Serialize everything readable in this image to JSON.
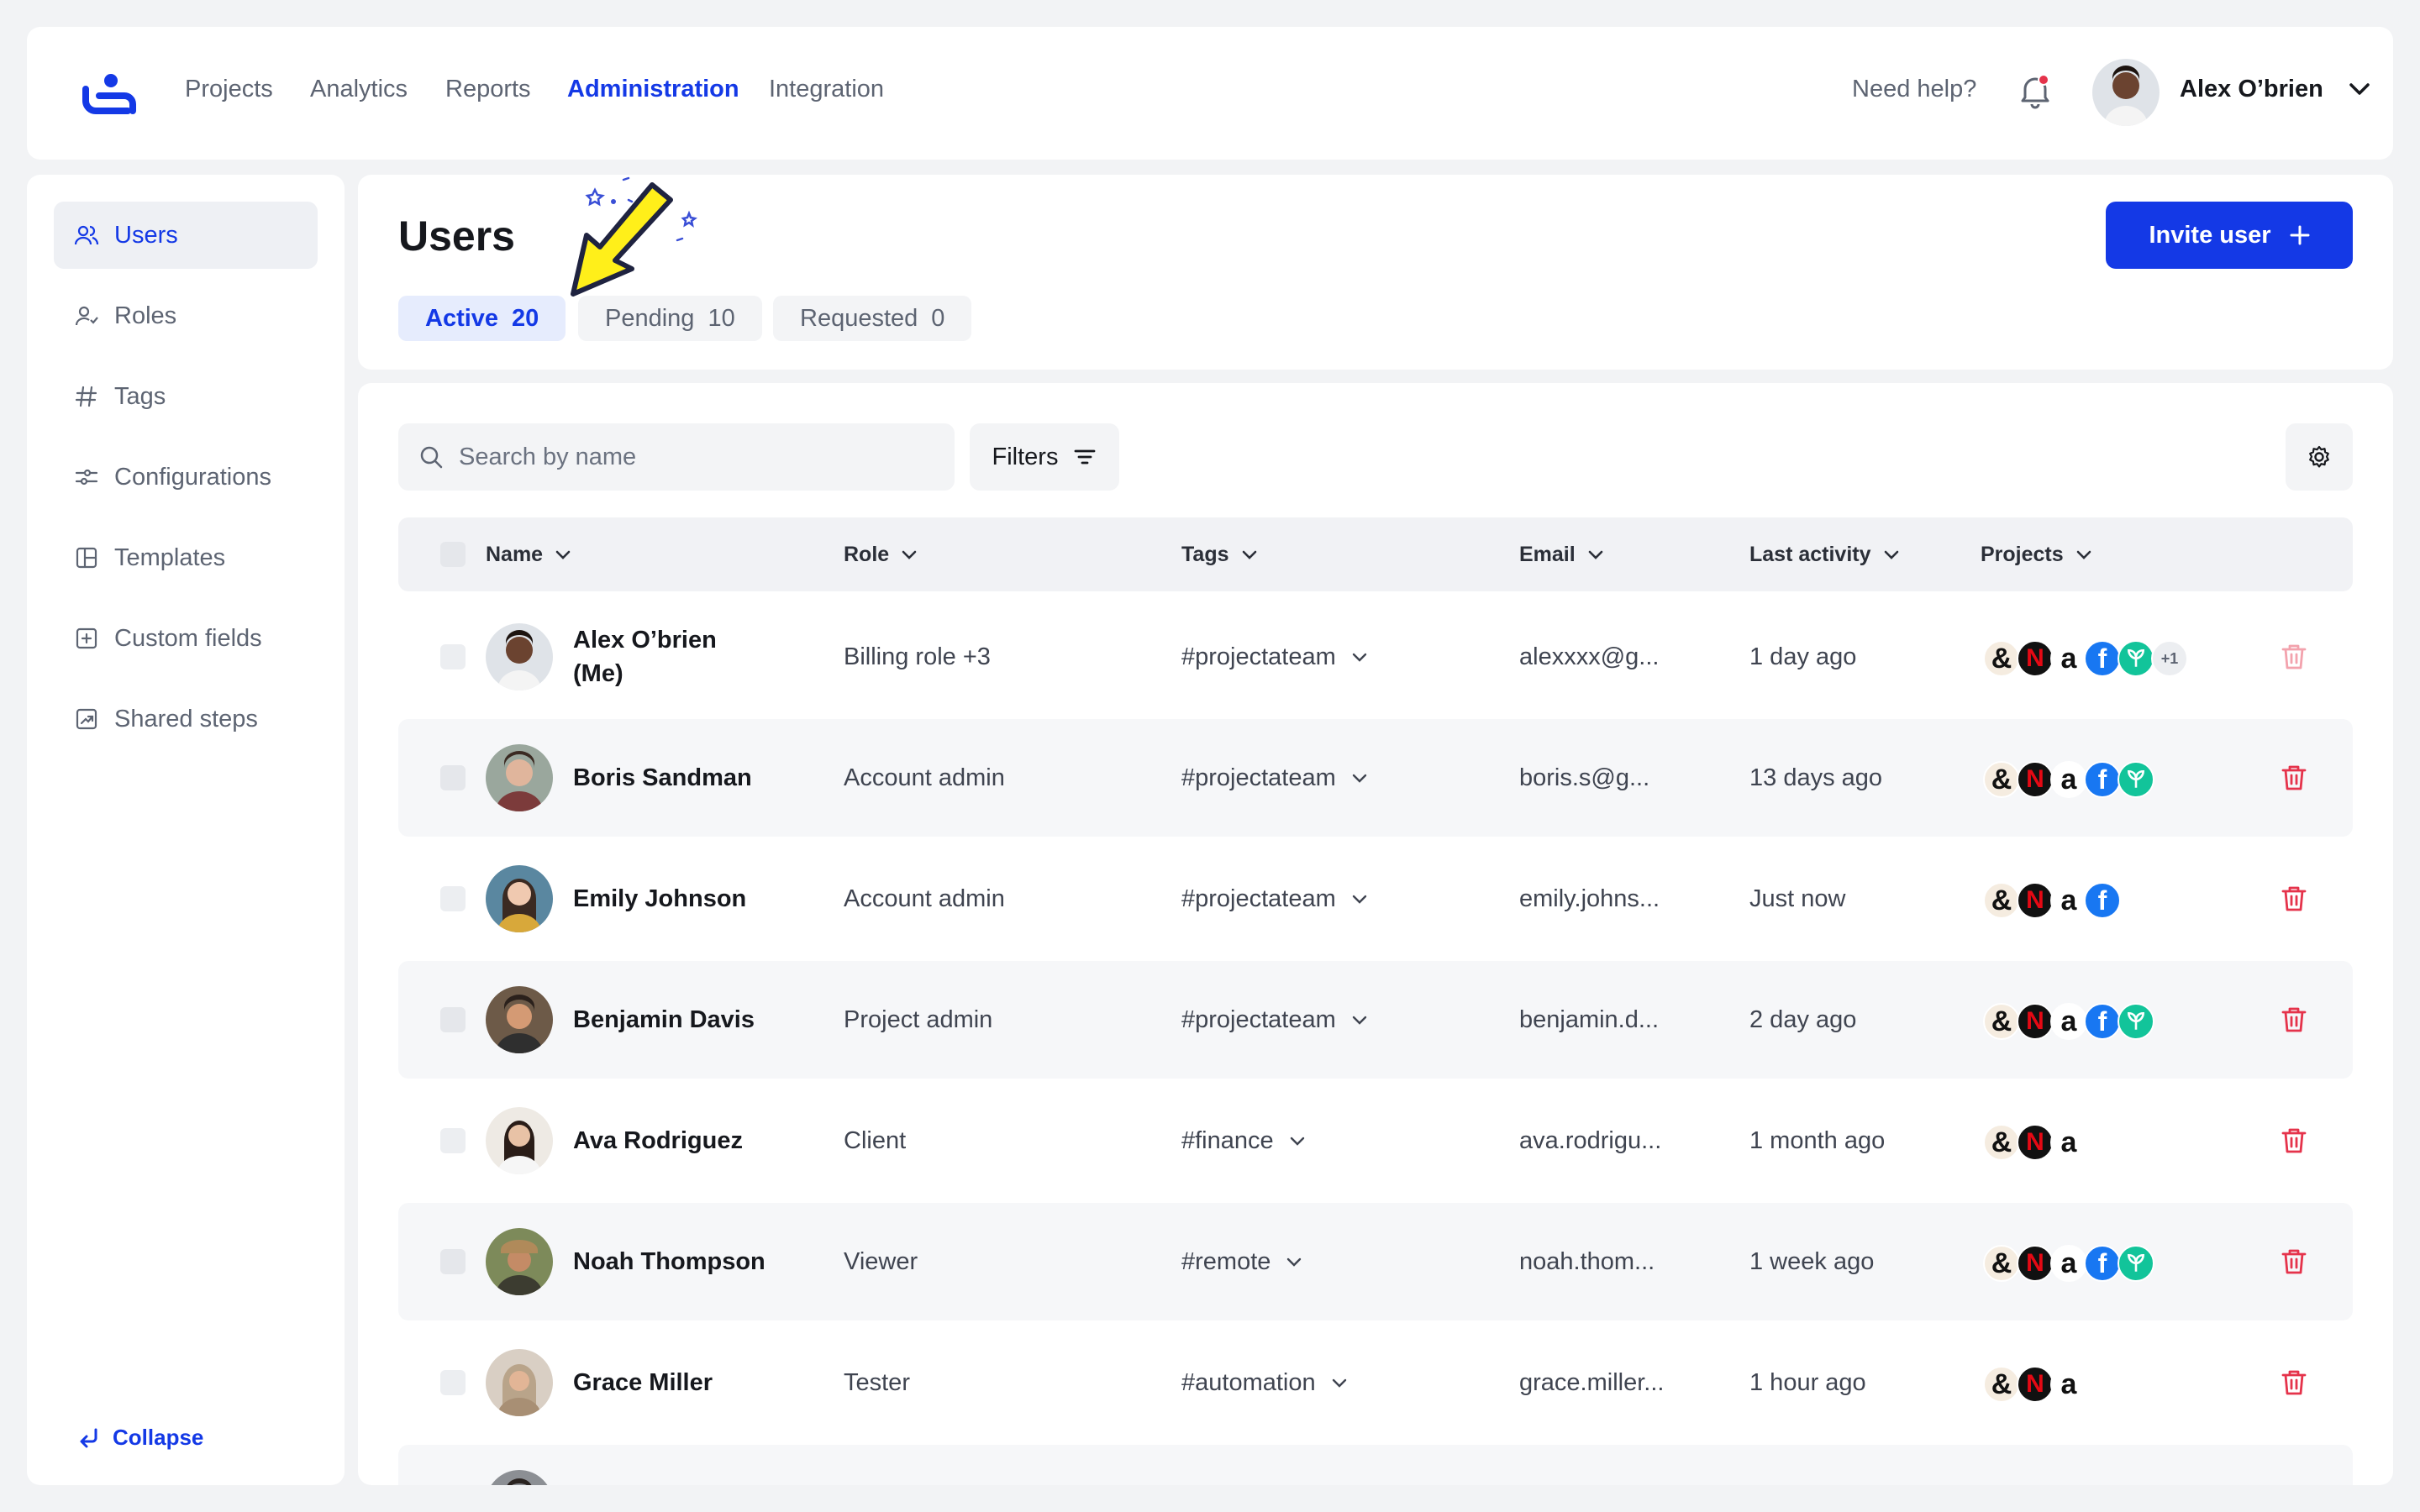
{
  "nav": {
    "links": [
      "Projects",
      "Analytics",
      "Reports",
      "Administration",
      "Integration"
    ],
    "active": "Administration",
    "help": "Need help?",
    "user_name": "Alex O’brien"
  },
  "sidebar": {
    "items": [
      "Users",
      "Roles",
      "Tags",
      "Configurations",
      "Templates",
      "Custom fields",
      "Shared steps"
    ],
    "collapse": "Collapse"
  },
  "page": {
    "title": "Users",
    "invite_label": "Invite user",
    "tabs": [
      {
        "label": "Active",
        "count": "20"
      },
      {
        "label": "Pending",
        "count": "10"
      },
      {
        "label": "Requested",
        "count": "0"
      }
    ]
  },
  "toolbar": {
    "search_placeholder": "Search by name",
    "filters_label": "Filters"
  },
  "table": {
    "columns": [
      "Name",
      "Role",
      "Tags",
      "Email",
      "Last activity",
      "Projects"
    ],
    "rows": [
      {
        "name": "Alex O’brien",
        "name2": "(Me)",
        "role": "Billing role +3",
        "tag": "#projectateam",
        "email": "alexxxx@g...",
        "activity": "1 day ago",
        "projects": [
          "&",
          "N",
          "a",
          "f",
          "leaf"
        ],
        "extra": "+1"
      },
      {
        "name": "Boris Sandman",
        "role": "Account admin",
        "tag": "#projectateam",
        "email": "boris.s@g...",
        "activity": "13 days ago",
        "projects": [
          "&",
          "N",
          "a",
          "f",
          "leaf"
        ]
      },
      {
        "name": "Emily Johnson",
        "role": "Account admin",
        "tag": "#projectateam",
        "email": "emily.johns...",
        "activity": "Just now",
        "projects": [
          "&",
          "N",
          "a",
          "f"
        ]
      },
      {
        "name": "Benjamin Davis",
        "role": "Project admin",
        "tag": "#projectateam",
        "email": "benjamin.d...",
        "activity": "2 day ago",
        "projects": [
          "&",
          "N",
          "a",
          "f",
          "leaf"
        ]
      },
      {
        "name": "Ava Rodriguez",
        "role": "Client",
        "tag": "#finance",
        "email": "ava.rodrigu...",
        "activity": "1 month ago",
        "projects": [
          "&",
          "N",
          "a"
        ]
      },
      {
        "name": "Noah Thompson",
        "role": "Viewer",
        "tag": "#remote",
        "email": "noah.thom...",
        "activity": "1 week ago",
        "projects": [
          "&",
          "N",
          "a",
          "f",
          "leaf"
        ]
      },
      {
        "name": "Grace Miller",
        "role": "Tester",
        "tag": "#automation",
        "email": "grace.miller...",
        "activity": "1 hour ago",
        "projects": [
          "&",
          "N",
          "a"
        ]
      }
    ]
  },
  "colors": {
    "accent": "#1439e6",
    "danger": "#e5334b",
    "highlight_arrow": "#ffef1a"
  }
}
